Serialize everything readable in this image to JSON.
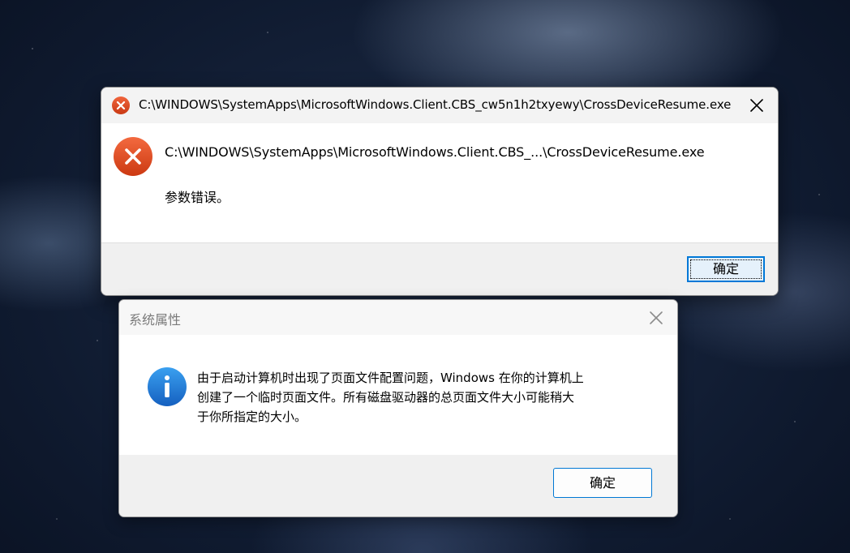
{
  "error_dialog": {
    "title": "C:\\WINDOWS\\SystemApps\\MicrosoftWindows.Client.CBS_cw5n1h2txyewy\\CrossDeviceResume.exe",
    "message_path": "C:\\WINDOWS\\SystemApps\\MicrosoftWindows.Client.CBS_...\\CrossDeviceResume.exe",
    "message_text": "参数错误。",
    "ok_label": "确定",
    "icon": "error-icon",
    "accent_color": "#e0441c"
  },
  "sysprop_dialog": {
    "title": "系统属性",
    "message_lines": [
      "由于启动计算机时出现了页面文件配置问题，Windows 在你的计算机上",
      "创建了一个临时页面文件。所有磁盘驱动器的总页面文件大小可能稍大",
      "于你所指定的大小。"
    ],
    "ok_label": "确定",
    "icon": "info-icon",
    "accent_color": "#1e88e5"
  }
}
